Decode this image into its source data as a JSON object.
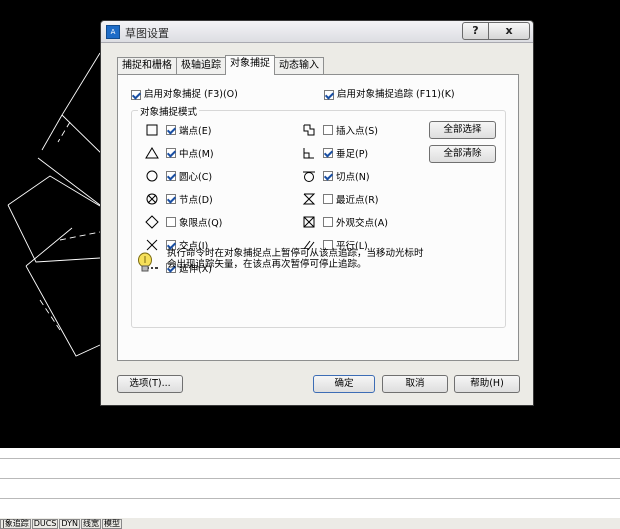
{
  "dialog": {
    "title": "草图设置",
    "help_glyph": "?",
    "close_glyph": "x",
    "tabs": [
      {
        "label": "捕捉和栅格"
      },
      {
        "label": "极轴追踪"
      },
      {
        "label": "对象捕捉"
      },
      {
        "label": "动态输入"
      }
    ],
    "enable_osnap": {
      "label": "启用对象捕捉 (F3)(O)",
      "checked": true
    },
    "enable_tracking": {
      "label": "启用对象捕捉追踪 (F11)(K)",
      "checked": true
    },
    "group_title": "对象捕捉模式",
    "modes": [
      {
        "icon": "endpoint-snap-icon",
        "label": "端点(E)",
        "checked": true
      },
      {
        "icon": "midpoint-snap-icon",
        "label": "中点(M)",
        "checked": true
      },
      {
        "icon": "center-snap-icon",
        "label": "圆心(C)",
        "checked": true
      },
      {
        "icon": "node-snap-icon",
        "label": "节点(D)",
        "checked": true
      },
      {
        "icon": "quadrant-snap-icon",
        "label": "象限点(Q)",
        "checked": false
      },
      {
        "icon": "intersection-snap-icon",
        "label": "交点(I)",
        "checked": true
      },
      {
        "icon": "extension-snap-icon",
        "label": "延伸(X)",
        "checked": true
      },
      {
        "icon": "insertion-snap-icon",
        "label": "插入点(S)",
        "checked": false
      },
      {
        "icon": "perpendicular-snap-icon",
        "label": "垂足(P)",
        "checked": true
      },
      {
        "icon": "tangent-snap-icon",
        "label": "切点(N)",
        "checked": true
      },
      {
        "icon": "nearest-snap-icon",
        "label": "最近点(R)",
        "checked": false
      },
      {
        "icon": "apparent-intersection-snap-icon",
        "label": "外观交点(A)",
        "checked": false
      },
      {
        "icon": "parallel-snap-icon",
        "label": "平行(L)",
        "checked": false
      }
    ],
    "select_all": "全部选择",
    "clear_all": "全部清除",
    "hint_line1": "执行命令时在对象捕捉点上暂停可从该点追踪，当移动光标时",
    "hint_line2": "会出现追踪矢量，在该点再次暂停可停止追踪。",
    "options_btn": "选项(T)...",
    "ok_btn": "确定",
    "cancel_btn": "取消",
    "help_btn": "帮助(H)"
  },
  "status_bar": {
    "items": [
      "|象追踪",
      "DUCS",
      "DYN",
      "线宽",
      "模型"
    ]
  },
  "colors": {
    "canvas": "#000000",
    "dialog_bg": "#ecebe6",
    "check_mark": "#1a4fa3"
  }
}
